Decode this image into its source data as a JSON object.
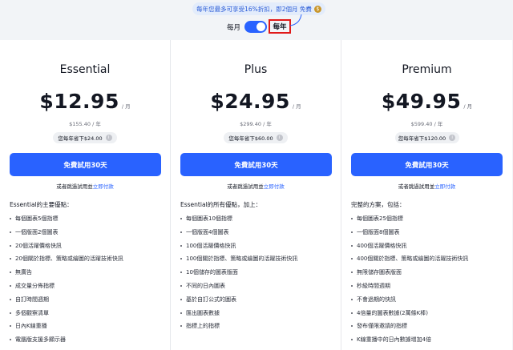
{
  "promo": {
    "text": "每年您最多可享受16%折扣，即2個月 免費",
    "icon": "coin-icon"
  },
  "billing_toggle": {
    "monthly_label": "每月",
    "yearly_label": "每年",
    "selected": "yearly"
  },
  "plans": [
    {
      "name": "Essential",
      "price": "$12.95",
      "per": "/ 月",
      "yearly": "$155.40 / 年",
      "saving": "您每年省下$24.00",
      "trial_label": "免費試用30天",
      "buynow_prefix": "或者跳過試用並",
      "buynow_link": "立即付款",
      "features_title": "Essential的主要優點：",
      "features": [
        "每個圖表5個指標",
        "一個版面2個圖表",
        "20個活躍價格快訊",
        "20個關於指標、策略或繪圖的活躍技術快訊",
        "無廣告",
        "成交量分佈指標",
        "自訂時間週期",
        "多個觀察清單",
        "日內K線重播",
        "電腦版支援多顯示器"
      ]
    },
    {
      "name": "Plus",
      "price": "$24.95",
      "per": "/ 月",
      "yearly": "$299.40 / 年",
      "saving": "您每年省下$60.00",
      "trial_label": "免費試用30天",
      "buynow_prefix": "或者跳過試用並",
      "buynow_link": "立即付款",
      "features_title": "Essential的所有優點，加上：",
      "features": [
        "每個圖表10個指標",
        "一個版面4個圖表",
        "100個活躍價格快訊",
        "100個關於指標、策略或繪圖的活躍技術快訊",
        "10個儲存的圖表版面",
        "不同的日內圖表",
        "基於自訂公式的圖表",
        "匯出圖表數據",
        "指標上的指標"
      ]
    },
    {
      "name": "Premium",
      "price": "$49.95",
      "per": "/ 月",
      "yearly": "$599.40 / 年",
      "saving": "您每年省下$120.00",
      "trial_label": "免費試用30天",
      "buynow_prefix": "或者跳過試用並",
      "buynow_link": "立即付款",
      "features_title": "完整的方案，包括：",
      "features": [
        "每個圖表25個指標",
        "一個版面8個圖表",
        "400個活躍價格快訊",
        "400個關於指標、策略或繪圖的活躍技術快訊",
        "無限儲存圖表版面",
        "秒級時間週期",
        "不會過期的快訊",
        "4倍量的圖表數據(2萬條K棒)",
        "發布僅限邀請的指標",
        "K線重播中的日內數據增加4倍"
      ]
    }
  ]
}
